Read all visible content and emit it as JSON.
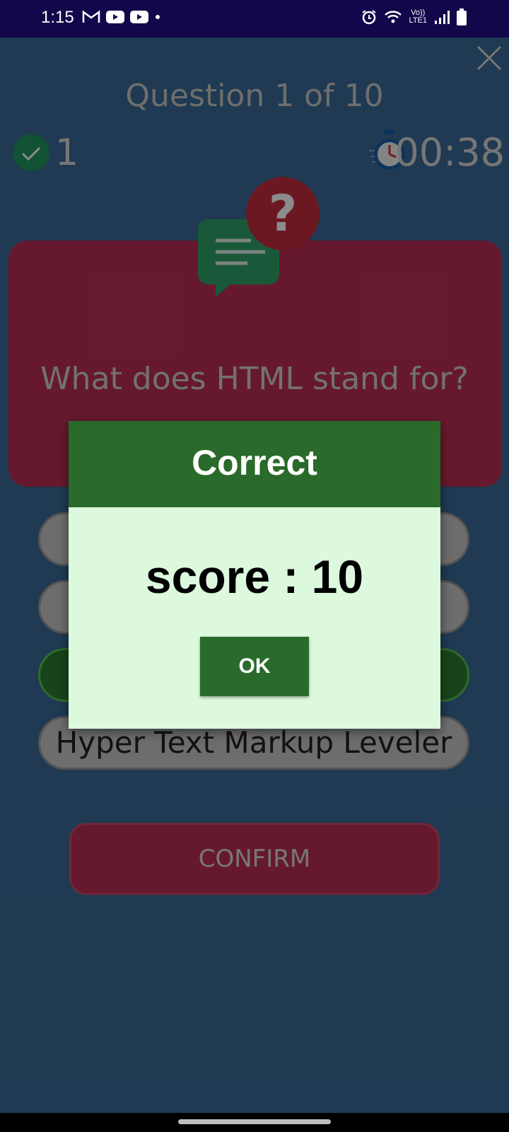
{
  "status_bar": {
    "time": "1:15",
    "left_icons": [
      "gmail-icon",
      "youtube-icon",
      "youtube-icon",
      "dot-icon"
    ],
    "right_icons": [
      "alarm-icon",
      "wifi-icon",
      "volte-icon",
      "signal-icon",
      "battery-icon"
    ],
    "volte_top": "Vo))",
    "volte_bottom": "LTE1"
  },
  "quiz": {
    "progress": "Question 1 of 10",
    "correct_count": "1",
    "timer": "00:38",
    "question": "What does HTML stand for?",
    "options": [
      {
        "label": "",
        "state": "default"
      },
      {
        "label": "",
        "state": "default"
      },
      {
        "label": "",
        "state": "correct"
      },
      {
        "label": "Hyper Text Markup Leveler",
        "state": "default"
      }
    ],
    "confirm_label": "CONFIRM"
  },
  "dialog": {
    "title": "Correct",
    "score_text": "score : 10",
    "ok_label": "OK"
  },
  "colors": {
    "accent_green": "#2a6a2a",
    "card_red": "#bb2e55",
    "background": "#3a6a96"
  }
}
